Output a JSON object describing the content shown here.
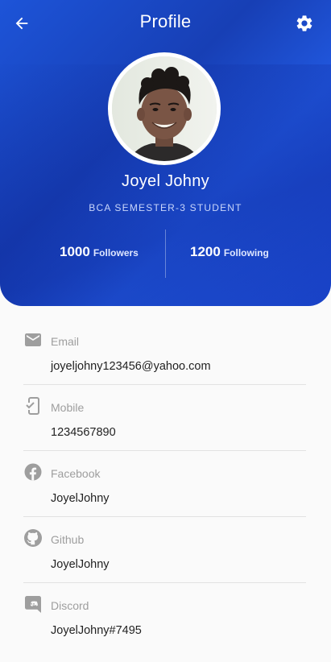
{
  "header": {
    "title": "Profile",
    "name": "Joyel Johny",
    "subtitle": "BCA SEMESTER-3 STUDENT",
    "icons": {
      "back": "arrow-left-icon",
      "settings": "gear-icon"
    }
  },
  "stats": {
    "followers_count": "1000",
    "followers_label": "Followers",
    "following_count": "1200",
    "following_label": "Following"
  },
  "info": [
    {
      "icon": "email-icon",
      "label": "Email",
      "value": "joyeljohny123456@yahoo.com"
    },
    {
      "icon": "mobile-icon",
      "label": "Mobile",
      "value": "1234567890"
    },
    {
      "icon": "facebook-icon",
      "label": "Facebook",
      "value": "JoyelJohny"
    },
    {
      "icon": "github-icon",
      "label": "Github",
      "value": "JoyelJohny"
    },
    {
      "icon": "discord-icon",
      "label": "Discord",
      "value": "JoyelJohny#7495"
    }
  ],
  "colors": {
    "header_gradient_start": "#1d54d8",
    "header_gradient_dark": "#173fb5",
    "icon_gray": "#9e9e9e",
    "background": "#fafafa"
  }
}
